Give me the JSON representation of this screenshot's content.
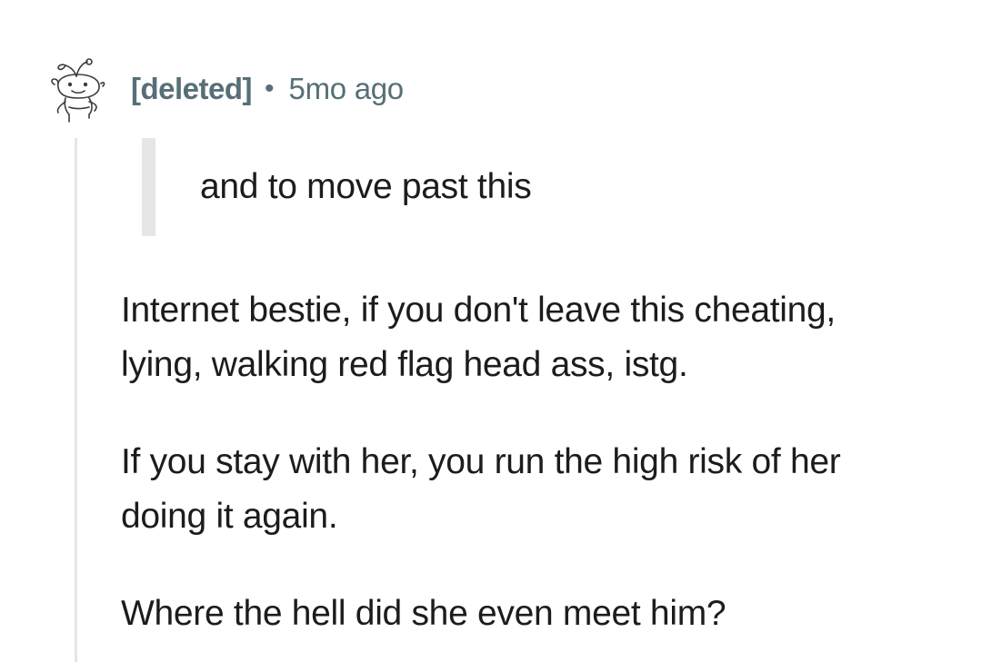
{
  "comment": {
    "author": "[deleted]",
    "separator": "•",
    "timestamp": "5mo ago",
    "avatar_icon": "snoo-avatar-icon",
    "quote": "and to move past this",
    "paragraphs": [
      {
        "lines": [
          "Internet bestie, if you don't leave this cheating,",
          "lying, walking red flag head ass, istg."
        ]
      },
      {
        "lines": [
          "If you stay with her, you run the high risk of her",
          "doing it again."
        ]
      },
      {
        "lines": [
          "Where the hell did she even meet him?"
        ]
      }
    ]
  },
  "colors": {
    "meta_text": "#576f76",
    "body_text": "#1c1c1c",
    "thread_line": "#e6e6e6",
    "background": "#ffffff"
  }
}
